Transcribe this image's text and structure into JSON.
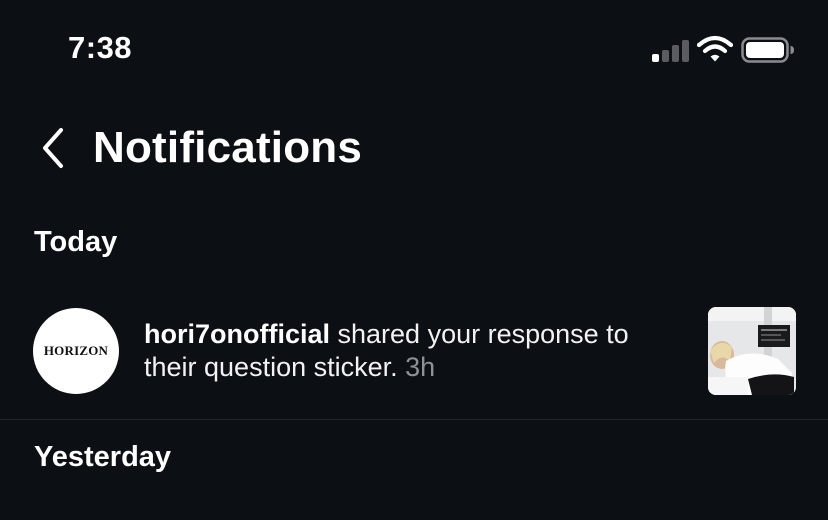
{
  "status_bar": {
    "time": "7:38"
  },
  "header": {
    "title": "Notifications",
    "back_icon": "chevron-left-icon"
  },
  "sections": [
    {
      "title": "Today",
      "notifications": [
        {
          "username": "hori7onofficial",
          "message": " shared your response to their question sticker. ",
          "time": "3h",
          "avatar_logo": "HORIZON",
          "thumbnail": "story-preview-image"
        }
      ]
    },
    {
      "title": "Yesterday"
    }
  ],
  "colors": {
    "background": "#0c0f14",
    "text_primary": "#ffffff",
    "text_secondary": "#8e9196",
    "divider": "#22252b"
  }
}
